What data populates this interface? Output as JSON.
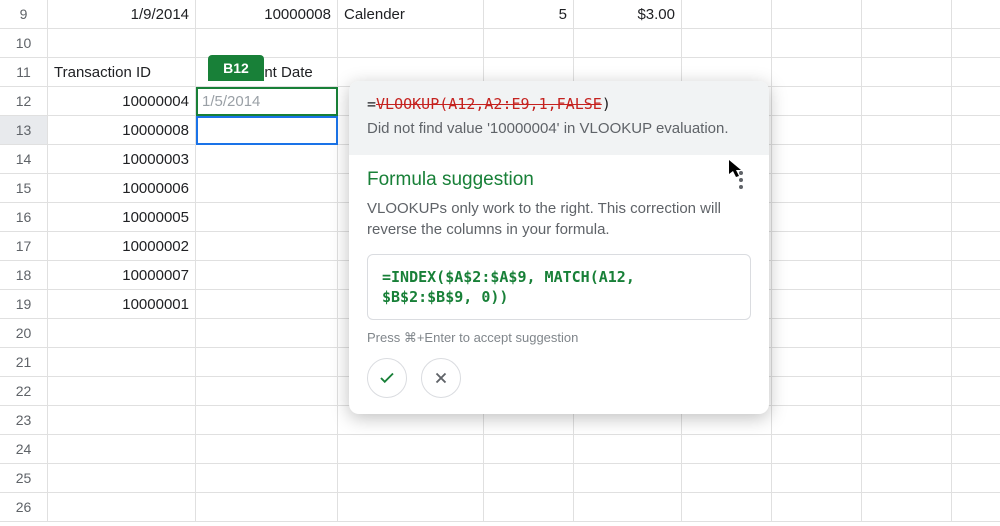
{
  "nameBox": "B12",
  "rows9": {
    "num": "9",
    "A": "1/9/2014",
    "B": "10000008",
    "C": "Calender",
    "D": "5",
    "E": "$3.00"
  },
  "headers": {
    "rownum": "11",
    "A": "Transaction ID",
    "B": "ent Date"
  },
  "ghostB12": "1/5/2014",
  "dataRows": [
    {
      "num": "12",
      "A": "10000004"
    },
    {
      "num": "13",
      "A": "10000008"
    },
    {
      "num": "14",
      "A": "10000003"
    },
    {
      "num": "15",
      "A": "10000006"
    },
    {
      "num": "16",
      "A": "10000005"
    },
    {
      "num": "17",
      "A": "10000002"
    },
    {
      "num": "18",
      "A": "10000007"
    },
    {
      "num": "19",
      "A": "10000001"
    }
  ],
  "blankRows": [
    "10",
    "20",
    "21",
    "22",
    "23",
    "24",
    "25",
    "26"
  ],
  "popup": {
    "eq": "=",
    "badFormula": "VLOOKUP(A12,A2:E9,1,FALSE",
    "close": ")",
    "errMsg": "Did not find value '10000004' in VLOOKUP evaluation.",
    "title": "Formula suggestion",
    "desc": "VLOOKUPs only work to the right. This correction will reverse the columns in your formula.",
    "suggLine1": "=INDEX($A$2:$A$9, MATCH(A12,",
    "suggLine2": "$B$2:$B$9, 0))",
    "hint": "Press ⌘+Enter to accept suggestion"
  }
}
